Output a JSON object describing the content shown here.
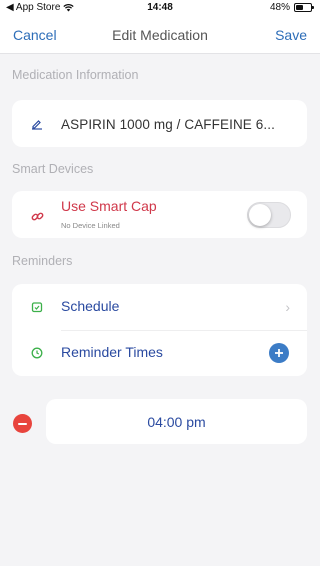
{
  "status_bar": {
    "back_app": "◀ App Store",
    "time": "14:48",
    "battery_text": "48%",
    "battery_level": 0.48
  },
  "nav": {
    "cancel": "Cancel",
    "title": "Edit Medication",
    "save": "Save"
  },
  "medication_info": {
    "header": "Medication Information",
    "name": "ASPIRIN 1000 mg / CAFFEINE 6..."
  },
  "smart_devices": {
    "header": "Smart Devices",
    "label": "Use Smart Cap",
    "sub_label": "No Device Linked",
    "toggle_on": false
  },
  "reminders": {
    "header": "Reminders",
    "schedule_label": "Schedule",
    "reminder_times_label": "Reminder Times"
  },
  "reminder_time": {
    "value": "04:00 pm"
  },
  "colors": {
    "accent_blue": "#2d6db8",
    "label_blue": "#2a4aa0",
    "link_red": "#d0384a",
    "icon_green": "#3cb04a",
    "delete_red": "#e8443d"
  },
  "icons": {
    "edit": "pencil-icon",
    "smart_cap": "link-icon",
    "schedule": "calendar-icon",
    "reminder_times": "clock-icon",
    "add": "plus-icon",
    "remove": "minus-icon"
  }
}
